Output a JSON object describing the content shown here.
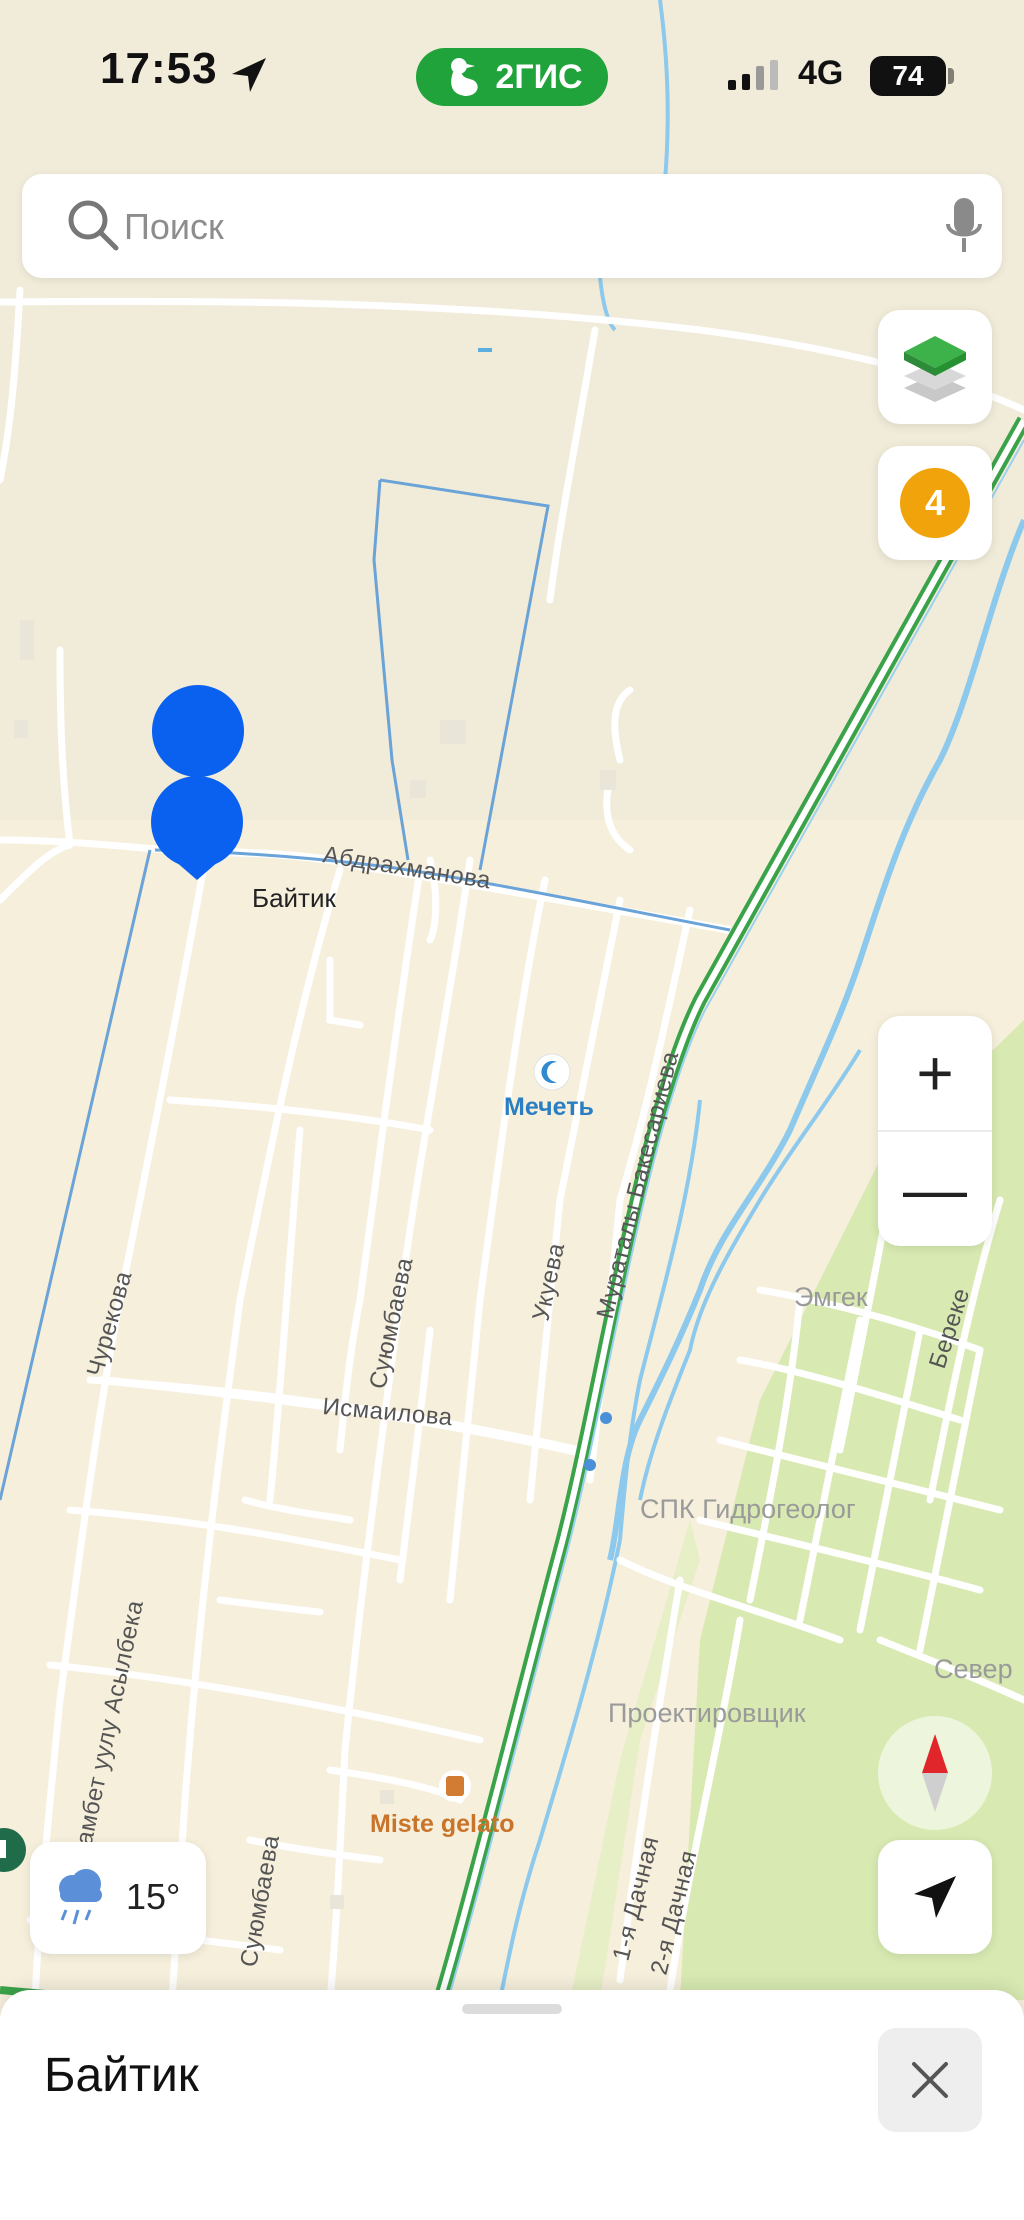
{
  "status_bar": {
    "time": "17:53",
    "brand": "2ГИС",
    "network": "4G",
    "battery": "74"
  },
  "search": {
    "placeholder": "Поиск"
  },
  "map": {
    "badge_count": "4",
    "labels": {
      "baitik": "Байтик",
      "abdrakhmanova": "Абдрахманова",
      "mosque": "Мечеть",
      "muratalу": "Мураталы Бакесариева",
      "ukueva": "Укуева",
      "suyumbaeva": "Суюмбаева",
      "suyumbaeva2": "Суюмбаева",
      "churekova": "Чурекова",
      "ismailova": "Исмаилова",
      "asylbeka": "ымамбет уулу Асылбека",
      "emgek": "Эмгек",
      "bereke": "Береке",
      "spk": "СПК Гидрогеолог",
      "proektirovshchik": "Проектировщик",
      "sever": "Север",
      "dachnaya1": "1-я Дачная",
      "dachnaya2": "2-я Дачная",
      "miste": "Miste gelato"
    },
    "colors": {
      "land": "#f6efdc",
      "green_area": "#d9ebb0",
      "river": "#8cc9ec",
      "highway": "#3aa34a",
      "boundary": "#6aa3d8",
      "pin": "#0a61f0"
    }
  },
  "zoom": {
    "in": "+",
    "out": "—"
  },
  "weather": {
    "temperature": "15°",
    "icon": "rain-cloud-icon"
  },
  "bottom_sheet": {
    "title": "Байтик"
  }
}
